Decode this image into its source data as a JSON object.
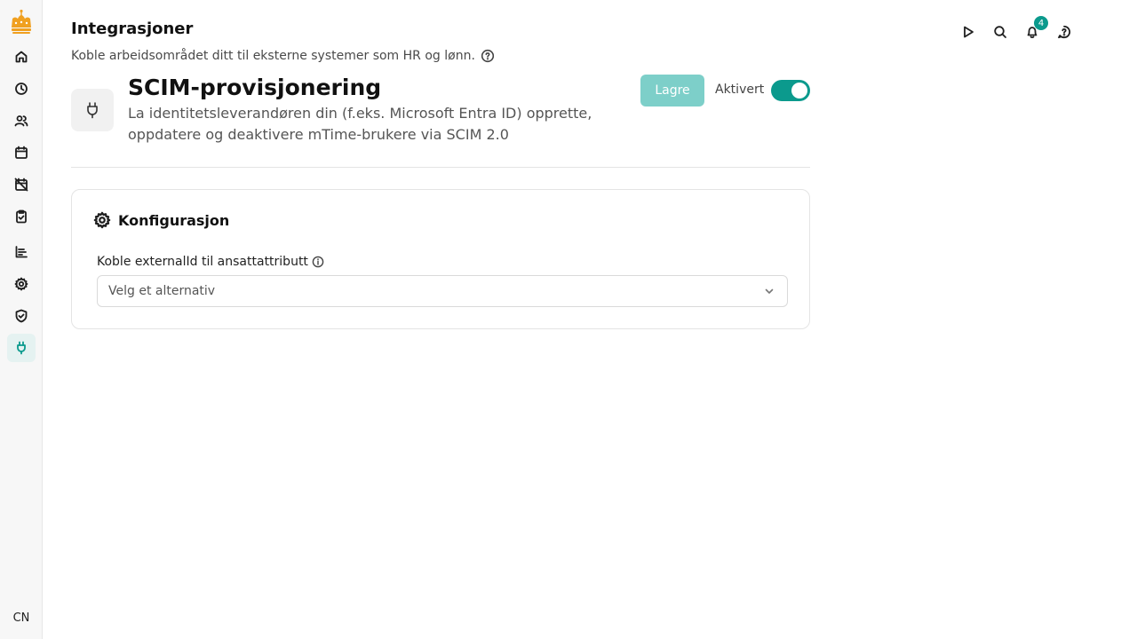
{
  "sidebar": {
    "logo_icon": "crown-logo",
    "items": [
      {
        "icon": "home-icon"
      },
      {
        "icon": "clock-icon"
      },
      {
        "icon": "users-icon"
      },
      {
        "icon": "calendar-icon"
      },
      {
        "icon": "calendar-off-icon"
      },
      {
        "icon": "clipboard-check-icon"
      },
      {
        "icon": "bar-chart-icon"
      },
      {
        "icon": "gear-icon"
      },
      {
        "icon": "shield-check-icon"
      },
      {
        "icon": "plug-icon",
        "active": true
      }
    ],
    "avatar_initials": "CN"
  },
  "topbar": {
    "icons": [
      "play-icon",
      "search-icon",
      "bell-icon",
      "help-chat-icon"
    ],
    "notification_count": "4"
  },
  "page": {
    "title": "Integrasjoner",
    "subtitle": "Koble arbeidsområdet ditt til eksterne systemer som HR og lønn."
  },
  "integration": {
    "title": "SCIM-provisjonering",
    "description": "La identitetsleverandøren din (f.eks. Microsoft Entra ID) opprette, oppdatere og deaktivere mTime-brukere via SCIM 2.0",
    "save_label": "Lagre",
    "toggle_label": "Aktivert",
    "enabled": true
  },
  "config": {
    "title": "Konfigurasjon",
    "field_label": "Koble externalId til ansattattributt",
    "select_placeholder": "Velg et alternativ"
  },
  "colors": {
    "accent": "#0b9a8d",
    "accent_light": "#7dcfc9",
    "logo": "#f0a020"
  }
}
